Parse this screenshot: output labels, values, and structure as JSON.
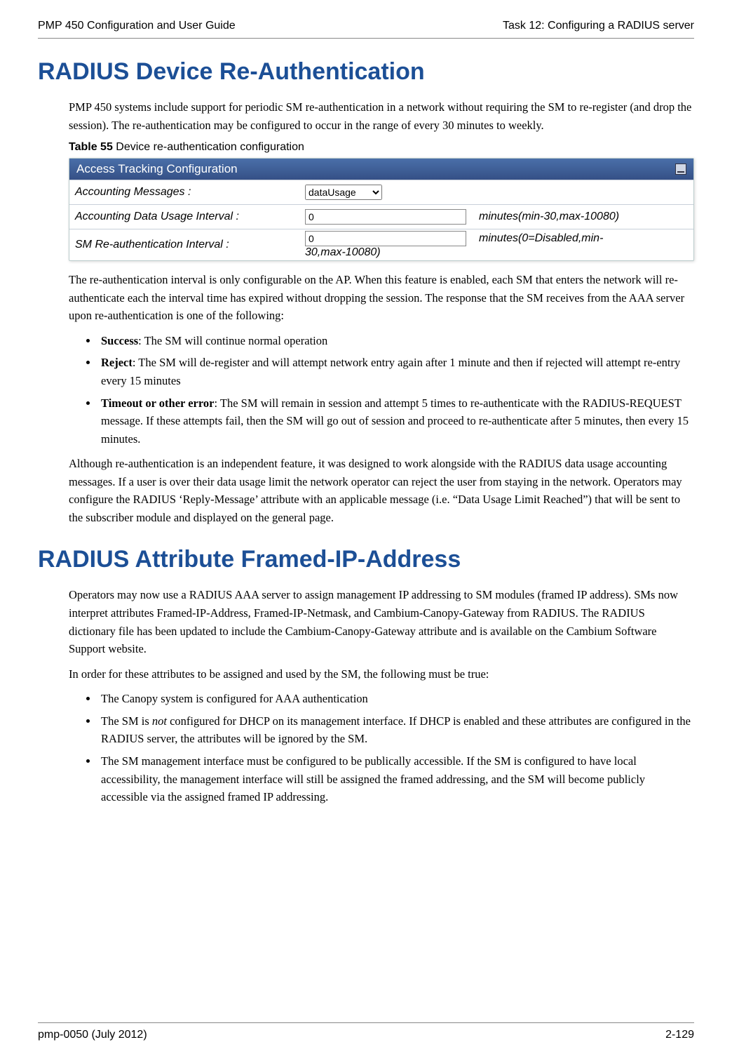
{
  "header": {
    "left": "PMP 450 Configuration and User Guide",
    "right": "Task 12: Configuring a RADIUS server"
  },
  "footer": {
    "left": "pmp-0050 (July 2012)",
    "right": "2-129"
  },
  "section1": {
    "heading": "RADIUS Device Re-Authentication",
    "intro": "PMP 450 systems include support for periodic SM re-authentication in a network without requiring the SM to re-register (and drop the session).  The re-authentication may be configured to occur in the range of every 30 minutes to weekly.",
    "table_caption_bold": "Table 55",
    "table_caption_rest": "  Device re-authentication configuration",
    "panel_title": "Access Tracking Configuration",
    "row1": {
      "label": "Accounting Messages :",
      "value": "dataUsage"
    },
    "row2": {
      "label": "Accounting Data Usage Interval :",
      "value": "0",
      "hint": "minutes(min-30,max-10080)"
    },
    "row3": {
      "label": "SM Re-authentication Interval :",
      "value": "0",
      "hint_pre": "minutes(0=Disabled,min-",
      "hint_post": "30,max-10080)"
    },
    "para2": "The re-authentication interval is only configurable on the AP.  When this feature is enabled, each SM that enters the network will re-authenticate each the interval time has expired without dropping the session.  The response that the SM receives from the AAA server upon re-authentication is one of the following:",
    "bullets": [
      {
        "bold": "Success",
        "rest": ":  The SM will continue normal operation"
      },
      {
        "bold": "Reject",
        "rest": ":  The SM will de-register and will attempt network entry again after 1 minute and then if rejected will attempt re-entry every 15 minutes"
      },
      {
        "bold": "Timeout or other error",
        "rest": ":  The SM will remain in session and attempt 5 times to re-authenticate with the RADIUS-REQUEST message.  If these attempts fail, then the SM will go out of session and proceed to re-authenticate after 5 minutes, then every 15 minutes."
      }
    ],
    "para3": "Although re-authentication is an independent feature, it was designed to work alongside with the RADIUS data usage accounting messages.  If a user is over their data usage limit the network operator can reject the user from staying in the network.  Operators may configure the RADIUS ‘Reply-Message’ attribute with an applicable message (i.e. “Data Usage Limit Reached”) that will be sent to the subscriber module and displayed on the general page."
  },
  "section2": {
    "heading": "RADIUS Attribute Framed-IP-Address",
    "para1": "Operators may now use a RADIUS AAA server to assign management IP addressing to SM modules (framed IP address).  SMs now interpret attributes Framed-IP-Address, Framed-IP-Netmask, and Cambium-Canopy-Gateway from RADIUS.  The RADIUS dictionary file has been updated to include the Cambium-Canopy-Gateway attribute and is available on the Cambium Software Support website.",
    "para2": "In order for these attributes to be assigned and used by the SM, the following must be true:",
    "bullets": [
      "The Canopy system is configured for AAA authentication",
      "__SM_NOT_DHCP__",
      "The SM management interface must be configured to be publically accessible.  If the SM is configured to have local accessibility, the management interface will still be assigned the framed addressing, and the SM will become publicly accessible via the assigned framed IP addressing."
    ],
    "bullet2_pre": "The SM is ",
    "bullet2_em": "not",
    "bullet2_post": " configured for DHCP on its management interface.  If DHCP is enabled and these attributes are configured in the RADIUS server, the attributes will be ignored by the SM."
  }
}
